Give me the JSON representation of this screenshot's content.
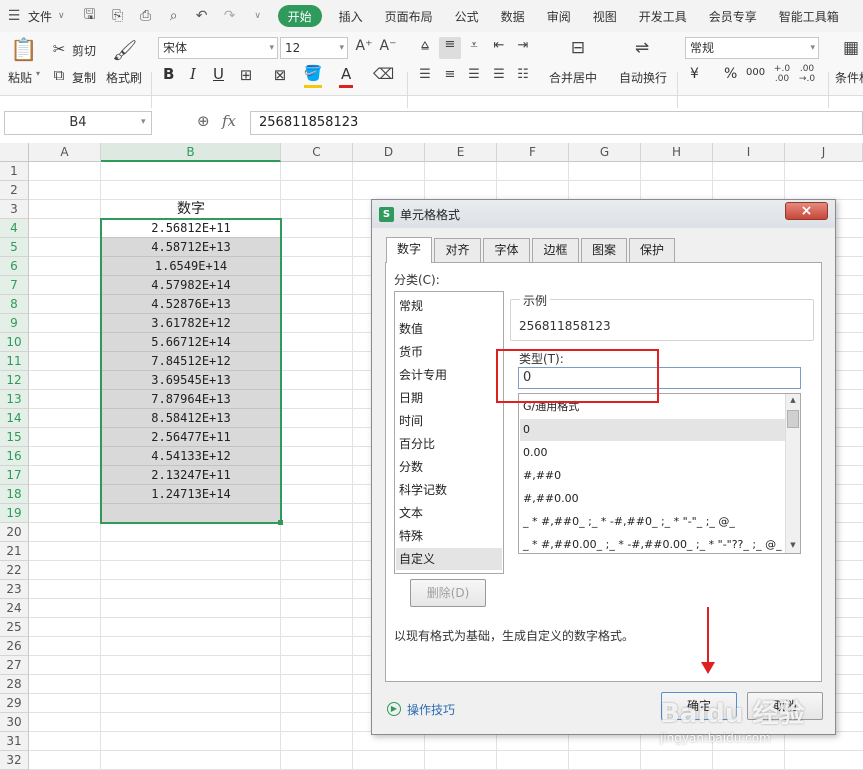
{
  "menubar": {
    "file": "文件",
    "tabs": [
      "开始",
      "插入",
      "页面布局",
      "公式",
      "数据",
      "审阅",
      "视图",
      "开发工具",
      "会员专享",
      "智能工具箱"
    ],
    "active": "开始"
  },
  "ribbon": {
    "paste": "粘贴",
    "cut": "剪切",
    "copy": "复制",
    "format_painter": "格式刷",
    "font_name": "宋体",
    "font_size": "12",
    "bold": "B",
    "italic": "I",
    "underline": "U",
    "font_color_letter": "A",
    "merge_center": "合并居中",
    "auto_wrap": "自动换行",
    "number_format": "常规",
    "currency": "¥",
    "percent": "%",
    "thousands": "000",
    "dec_inc": "+.0\n.00",
    "dec_dec": ".00\n→.0",
    "conditional": "条件格"
  },
  "formula_bar": {
    "name_box": "B4",
    "fx": "fx",
    "value": "256811858123"
  },
  "sheet": {
    "columns": [
      "A",
      "B",
      "C",
      "D",
      "E",
      "F",
      "G",
      "H",
      "I",
      "J"
    ],
    "rows": [
      "1",
      "2",
      "3",
      "4",
      "5",
      "6",
      "7",
      "8",
      "9",
      "10",
      "11",
      "12",
      "13",
      "14",
      "15",
      "16",
      "17",
      "18",
      "19",
      "20",
      "21",
      "22",
      "23",
      "24",
      "25",
      "26",
      "27",
      "28",
      "29",
      "30",
      "31",
      "32"
    ],
    "header_cell": "数字",
    "values": [
      "2.56812E+11",
      "4.58712E+13",
      "1.6549E+14",
      "4.57982E+14",
      "4.52876E+13",
      "3.61782E+12",
      "5.66712E+14",
      "7.84512E+12",
      "3.69545E+13",
      "7.87964E+13",
      "8.58412E+13",
      "2.56477E+11",
      "4.54133E+12",
      "2.13247E+11",
      "1.24713E+14"
    ]
  },
  "dialog": {
    "title": "单元格格式",
    "close": "×",
    "tabs": [
      "数字",
      "对齐",
      "字体",
      "边框",
      "图案",
      "保护"
    ],
    "active_tab": "数字",
    "category_label": "分类(C):",
    "categories": [
      "常规",
      "数值",
      "货币",
      "会计专用",
      "日期",
      "时间",
      "百分比",
      "分数",
      "科学记数",
      "文本",
      "特殊",
      "自定义"
    ],
    "selected_category": "自定义",
    "sample_label": "示例",
    "sample_value": "256811858123",
    "type_label": "类型(T):",
    "type_value": "0",
    "format_list": [
      "G/通用格式",
      "0",
      "0.00",
      "#,##0",
      "#,##0.00",
      "_ * #,##0_ ;_ * -#,##0_ ;_ * \"-\"_ ;_ @_",
      "_ * #,##0.00_ ;_ * -#,##0.00_ ;_ * \"-\"??_ ;_ @_"
    ],
    "selected_format": "0",
    "delete_button": "删除(D)",
    "description": "以现有格式为基础，生成自定义的数字格式。",
    "tips_link": "操作技巧",
    "ok_button": "确定",
    "cancel_button": "取消"
  },
  "watermark": {
    "text": "Baidu 经验",
    "url_text": "jingyan.baidu.com"
  },
  "colors": {
    "accent_green": "#2f9a5b",
    "annotation_red": "#e02020",
    "selection_fill": "#d9d9d9"
  }
}
